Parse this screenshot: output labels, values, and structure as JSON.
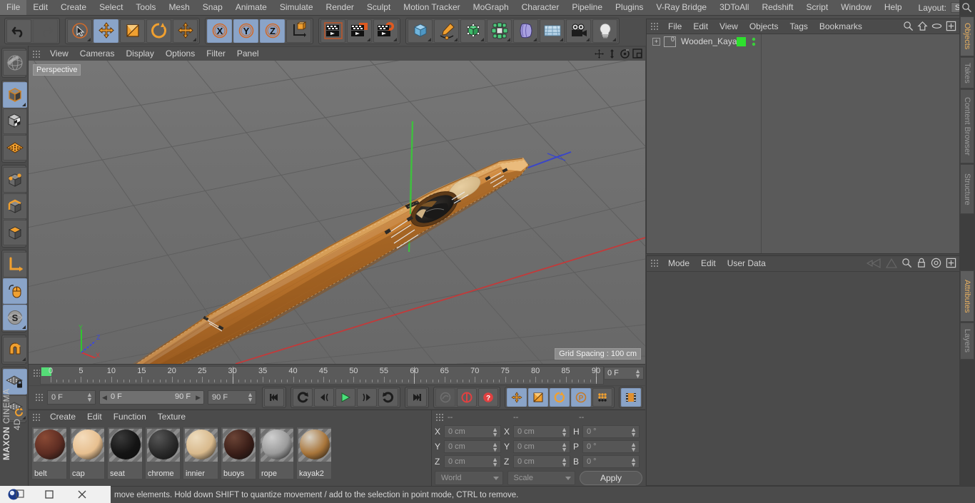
{
  "menubar": {
    "items": [
      "File",
      "Edit",
      "Create",
      "Select",
      "Tools",
      "Mesh",
      "Snap",
      "Animate",
      "Simulate",
      "Render",
      "Sculpt",
      "Motion Tracker",
      "MoGraph",
      "Character",
      "Pipeline",
      "Plugins",
      "V-Ray Bridge",
      "3DToAll",
      "Redshift",
      "Script",
      "Window",
      "Help"
    ],
    "layout_label": "Layout:",
    "layout_value": "Startup",
    "search_icon": "search-icon"
  },
  "toolbar": {
    "groups": [
      {
        "name": "undo-redo",
        "buttons": [
          {
            "icon": "undo-icon",
            "label": "Undo",
            "selected": false,
            "disabled": false
          },
          {
            "icon": "redo-icon",
            "label": "Redo",
            "selected": false,
            "disabled": true
          }
        ]
      },
      {
        "name": "tools",
        "buttons": [
          {
            "icon": "live-selection-icon",
            "label": "Live Selection",
            "selected": false
          },
          {
            "icon": "move-icon",
            "label": "Move",
            "selected": true
          },
          {
            "icon": "scale-icon",
            "label": "Scale",
            "selected": false
          },
          {
            "icon": "rotate-icon",
            "label": "Rotate",
            "selected": false
          },
          {
            "icon": "move-dup-icon",
            "label": "Move",
            "selected": false
          }
        ]
      },
      {
        "name": "axis-locks",
        "buttons": [
          {
            "icon": "x-axis-icon",
            "label": "X",
            "selected": true
          },
          {
            "icon": "y-axis-icon",
            "label": "Y",
            "selected": true
          },
          {
            "icon": "z-axis-icon",
            "label": "Z",
            "selected": true
          },
          {
            "icon": "world-object-axis-icon",
            "label": "World/Object",
            "selected": false
          }
        ]
      },
      {
        "name": "render",
        "buttons": [
          {
            "icon": "render-view-icon",
            "label": "Render View",
            "selected": false
          },
          {
            "icon": "render-region-icon",
            "label": "Render to Picture Viewer",
            "selected": false
          },
          {
            "icon": "render-settings-icon",
            "label": "Edit Render Settings",
            "selected": false
          }
        ]
      },
      {
        "name": "objects",
        "buttons": [
          {
            "icon": "cube-primitive-icon",
            "label": "Cube",
            "selected": false
          },
          {
            "icon": "spline-pen-icon",
            "label": "Spline Pen",
            "selected": false
          },
          {
            "icon": "nurbs-icon",
            "label": "Subdivision Surface",
            "selected": false
          },
          {
            "icon": "array-icon",
            "label": "Array",
            "selected": false
          },
          {
            "icon": "deformer-icon",
            "label": "Bend",
            "selected": false
          },
          {
            "icon": "floor-icon",
            "label": "Floor",
            "selected": false
          },
          {
            "icon": "camera-icon",
            "label": "Camera",
            "selected": false
          },
          {
            "icon": "light-icon",
            "label": "Light",
            "selected": false
          }
        ]
      }
    ]
  },
  "lefttools": {
    "groups": [
      {
        "buttons": [
          {
            "icon": "make-editable-icon",
            "label": "Make Editable",
            "selected": false
          }
        ]
      },
      {
        "buttons": [
          {
            "icon": "model-mode-icon",
            "label": "Model Mode",
            "selected": true
          },
          {
            "icon": "texture-mode-icon",
            "label": "Texture Mode",
            "selected": false
          },
          {
            "icon": "workplane-mode-icon",
            "label": "Workplane",
            "selected": false
          }
        ]
      },
      {
        "buttons": [
          {
            "icon": "point-mode-icon",
            "label": "Points",
            "selected": false
          },
          {
            "icon": "edge-mode-icon",
            "label": "Edges",
            "selected": false
          },
          {
            "icon": "polygon-mode-icon",
            "label": "Polygons",
            "selected": false
          }
        ]
      },
      {
        "buttons": [
          {
            "icon": "axis-mode-icon",
            "label": "Enable Axis",
            "selected": false
          },
          {
            "icon": "viewport-solo-icon",
            "label": "Viewport Solo",
            "selected": true
          },
          {
            "icon": "soft-selection-icon",
            "label": "Soft Selection",
            "selected": true
          }
        ]
      },
      {
        "buttons": [
          {
            "icon": "magnet-icon",
            "label": "Magnet",
            "selected": false
          }
        ]
      },
      {
        "buttons": [
          {
            "icon": "workplane-lock-icon",
            "label": "Lock Workplane",
            "selected": true
          },
          {
            "icon": "planar-workplane-icon",
            "label": "Planar Workplane",
            "selected": false
          }
        ]
      }
    ],
    "brand_top": "MAXON",
    "brand_bottom": "CINEMA 4D"
  },
  "viewport": {
    "menus": [
      "View",
      "Cameras",
      "Display",
      "Options",
      "Filter",
      "Panel"
    ],
    "perspective_label": "Perspective",
    "grid_spacing_label": "Grid Spacing : 100 cm",
    "header_icons": [
      "pan-icon",
      "dolly-icon",
      "orbit-icon",
      "maximize-icon"
    ],
    "axis_gizmo": {
      "x": "X",
      "y": "Y",
      "z": "Z"
    },
    "scene_object": "wooden kayak"
  },
  "timeline": {
    "ticks": [
      0,
      5,
      10,
      15,
      20,
      25,
      30,
      35,
      40,
      45,
      50,
      55,
      60,
      65,
      70,
      75,
      80,
      85,
      90
    ],
    "current_frame_field": "0 F",
    "playhead_frame": 0
  },
  "playbar": {
    "current_frame": "0 F",
    "range_start": "0 F",
    "range_end": "90 F",
    "max_frame": "90 F",
    "transport": [
      {
        "icon": "go-to-start-icon",
        "label": "Go to Start",
        "selected": false
      },
      {
        "icon": "step-back-keyframe-icon",
        "label": "Go to Previous Key",
        "selected": false
      },
      {
        "icon": "step-back-frame-icon",
        "label": "Go to Previous Frame",
        "selected": false
      },
      {
        "icon": "play-icon",
        "label": "Play",
        "selected": false
      },
      {
        "icon": "step-forward-frame-icon",
        "label": "Go to Next Frame",
        "selected": false
      },
      {
        "icon": "step-forward-keyframe-icon",
        "label": "Go to Next Key",
        "selected": false
      },
      {
        "icon": "go-to-end-icon",
        "label": "Go to End",
        "selected": false
      }
    ],
    "record": [
      {
        "icon": "record-key-icon",
        "label": "Record Active Objects",
        "selected": false,
        "disabled": true
      },
      {
        "icon": "autokey-icon",
        "label": "Autokeying",
        "selected": false
      },
      {
        "icon": "keyframe-selection-icon",
        "label": "Keyframe Selection",
        "selected": false
      }
    ],
    "keyflags": [
      {
        "icon": "position-key-icon",
        "label": "Position",
        "selected": true
      },
      {
        "icon": "scale-key-icon",
        "label": "Scale",
        "selected": true
      },
      {
        "icon": "rotation-key-icon",
        "label": "Rotation",
        "selected": true
      },
      {
        "icon": "param-key-icon",
        "label": "Parameter",
        "selected": true
      },
      {
        "icon": "pla-key-icon",
        "label": "Point Level Animation",
        "selected": false
      }
    ],
    "timeline_toggle": {
      "icon": "timeline-icon",
      "label": "Timeline",
      "selected": true
    }
  },
  "material_manager": {
    "menus": [
      "Create",
      "Edit",
      "Function",
      "Texture"
    ],
    "materials": [
      {
        "name": "belt",
        "color": "#5c2c22",
        "highlight": "#8a4a35"
      },
      {
        "name": "cap",
        "color": "#e7bf8f",
        "highlight": "#f4dcbc"
      },
      {
        "name": "seat",
        "color": "#141414",
        "highlight": "#3a3a3a"
      },
      {
        "name": "chrome",
        "color": "#2a2a2a",
        "highlight": "#565656"
      },
      {
        "name": "innier",
        "color": "#d8b98c",
        "highlight": "#eddcbe"
      },
      {
        "name": "buoys",
        "color": "#3a1e18",
        "highlight": "#6b4436"
      },
      {
        "name": "rope",
        "color": "#9a9a9a",
        "highlight": "#cfcfcf"
      },
      {
        "name": "kayak2",
        "color": "#a8753a",
        "highlight": "#d8d2c6"
      }
    ]
  },
  "coordinate_manager": {
    "headers": [
      "--",
      "--",
      "--"
    ],
    "rows": [
      {
        "label1": "X",
        "value1": "0 cm",
        "label2": "X",
        "value2": "0 cm",
        "label3": "H",
        "value3": "0 °"
      },
      {
        "label1": "Y",
        "value1": "0 cm",
        "label2": "Y",
        "value2": "0 cm",
        "label3": "P",
        "value3": "0 °"
      },
      {
        "label1": "Z",
        "value1": "0 cm",
        "label2": "Z",
        "value2": "0 cm",
        "label3": "B",
        "value3": "0 °"
      }
    ],
    "coord_system": "World",
    "size_mode": "Scale",
    "apply_label": "Apply"
  },
  "object_manager": {
    "menus": [
      "File",
      "Edit",
      "View",
      "Objects",
      "Tags",
      "Bookmarks"
    ],
    "icons": [
      "search-icon",
      "home-icon",
      "ellipse-icon",
      "plus-box-icon"
    ],
    "objects": [
      {
        "name": "Wooden_Kayak",
        "visible_dot_color": "#2ee02e",
        "expandable": true
      }
    ]
  },
  "attribute_manager": {
    "menus": [
      "Mode",
      "Edit",
      "User Data"
    ],
    "icons": [
      "prev-icon",
      "next-icon",
      "search-icon",
      "lock-icon",
      "target-icon",
      "plus-box-icon"
    ]
  },
  "right_tabs": {
    "top": [
      {
        "label": "Objects",
        "active": true
      },
      {
        "label": "Takes",
        "active": false
      },
      {
        "label": "Content Browser",
        "active": false
      },
      {
        "label": "Structure",
        "active": false
      }
    ],
    "bottom": [
      {
        "label": "Attributes",
        "active": true
      },
      {
        "label": "Layers",
        "active": false
      }
    ]
  },
  "statusbar": {
    "message": "move elements. Hold down SHIFT to quantize movement / add to the selection in point mode, CTRL to remove."
  },
  "taskbar": {
    "buttons": [
      "app-icon",
      "restore-icon",
      "minimize-icon",
      "close-icon"
    ]
  }
}
